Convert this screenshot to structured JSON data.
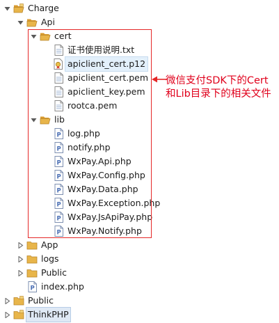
{
  "tree": [
    {
      "label": "Charge",
      "depth": 0,
      "expanded": true,
      "type": "folder-project",
      "icon": "project-folder-icon"
    },
    {
      "label": "Api",
      "depth": 1,
      "expanded": true,
      "type": "folder",
      "icon": "folder-icon"
    },
    {
      "label": "cert",
      "depth": 2,
      "expanded": true,
      "type": "folder",
      "icon": "folder-icon"
    },
    {
      "label": "证书使用说明.txt",
      "depth": 3,
      "type": "file-text",
      "icon": "text-file-icon"
    },
    {
      "label": "apiclient_cert.p12",
      "depth": 3,
      "type": "file-cert",
      "icon": "certificate-file-icon",
      "selected": true
    },
    {
      "label": "apiclient_cert.pem",
      "depth": 3,
      "type": "file-text",
      "icon": "text-file-icon"
    },
    {
      "label": "apiclient_key.pem",
      "depth": 3,
      "type": "file-text",
      "icon": "text-file-icon"
    },
    {
      "label": "rootca.pem",
      "depth": 3,
      "type": "file-text",
      "icon": "text-file-icon"
    },
    {
      "label": "lib",
      "depth": 2,
      "expanded": true,
      "type": "folder",
      "icon": "folder-icon"
    },
    {
      "label": "log.php",
      "depth": 3,
      "type": "file-php",
      "icon": "php-file-icon"
    },
    {
      "label": "notify.php",
      "depth": 3,
      "type": "file-php",
      "icon": "php-file-icon"
    },
    {
      "label": "WxPay.Api.php",
      "depth": 3,
      "type": "file-php",
      "icon": "php-file-icon"
    },
    {
      "label": "WxPay.Config.php",
      "depth": 3,
      "type": "file-php",
      "icon": "php-file-icon"
    },
    {
      "label": "WxPay.Data.php",
      "depth": 3,
      "type": "file-php",
      "icon": "php-file-icon"
    },
    {
      "label": "WxPay.Exception.php",
      "depth": 3,
      "type": "file-php",
      "icon": "php-file-icon"
    },
    {
      "label": "WxPay.JsApiPay.php",
      "depth": 3,
      "type": "file-php",
      "icon": "php-file-icon"
    },
    {
      "label": "WxPay.Notify.php",
      "depth": 3,
      "type": "file-php",
      "icon": "php-file-icon"
    },
    {
      "label": "App",
      "depth": 1,
      "expanded": false,
      "type": "folder",
      "icon": "folder-icon"
    },
    {
      "label": "logs",
      "depth": 1,
      "expanded": false,
      "type": "folder",
      "icon": "folder-icon"
    },
    {
      "label": "Public",
      "depth": 1,
      "expanded": false,
      "type": "folder",
      "icon": "folder-icon"
    },
    {
      "label": "index.php",
      "depth": 1,
      "type": "file-php",
      "icon": "php-file-icon"
    },
    {
      "label": "Public",
      "depth": 0,
      "expanded": false,
      "type": "folder-project",
      "icon": "project-folder-icon"
    },
    {
      "label": "ThinkPHP",
      "depth": 0,
      "expanded": false,
      "type": "folder-project",
      "icon": "project-folder-icon",
      "highlighted": true
    }
  ],
  "annotation": {
    "text": "微信支付SDK下的Cert和Lib目录下的相关文件",
    "color": "#e0001b"
  },
  "colors": {
    "highlight_box": "#e52828",
    "folder": "#e8b54a",
    "php_icon": "#4a6fb5",
    "selection": "#e3f0fb"
  }
}
